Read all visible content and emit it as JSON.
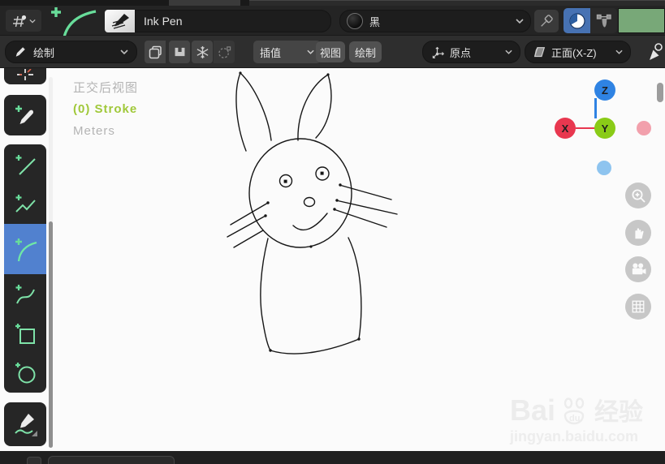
{
  "colors": {
    "accent_blue": "#4772b3",
    "tool_selected_blue": "#5181cf",
    "tool_green": "#68dd9a",
    "swatch_green": "#78a878",
    "axis_x_red": "#e8374f",
    "axis_y_green": "#8acb17",
    "axis_z_blue": "#2f83e3",
    "axis_neg_x_pink": "#f2a0ac",
    "axis_neg_z_lightblue": "#8ec4ef",
    "overlay_green": "#a0c83a"
  },
  "header": {
    "brush": {
      "name": "Ink Pen"
    },
    "material": {
      "name": "黑"
    }
  },
  "toolbar": {
    "mode": "绘制",
    "interpolate": "插值",
    "view_menu": "视图",
    "draw_menu": "绘制",
    "origin": "原点",
    "orientation": "正面(X-Z)"
  },
  "viewport": {
    "view_label": "正交后视图",
    "stroke_label": "(0) Stroke",
    "units_label": "Meters",
    "gizmo": {
      "x": "X",
      "y": "Y",
      "z": "Z"
    }
  },
  "watermark": {
    "part1": "Bai",
    "part2": "du",
    "part3": "经验",
    "url": "jingyan.baidu.com"
  },
  "sidebar": {
    "tools": [
      "cursor",
      "draw",
      "line",
      "polyline",
      "arc",
      "curve",
      "box",
      "circle",
      "annotate"
    ],
    "selected_tool": "arc"
  }
}
